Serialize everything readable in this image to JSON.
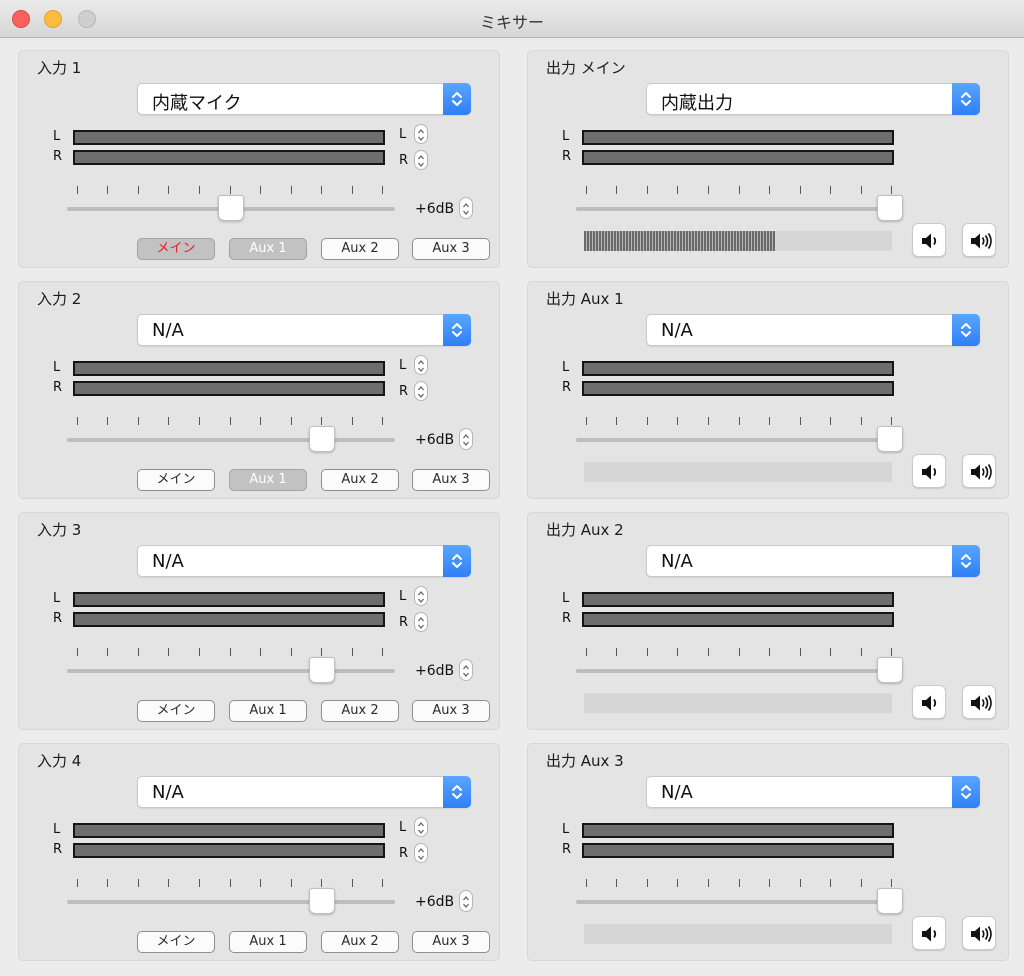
{
  "window": {
    "title": "ミキサー"
  },
  "inputs": [
    {
      "title": "入力 1",
      "source": "内蔵マイク",
      "level_fraction": 0.5,
      "gain_label": "+6dB",
      "routes": [
        {
          "label": "メイン",
          "state": "alert"
        },
        {
          "label": "Aux 1",
          "state": "active"
        },
        {
          "label": "Aux 2",
          "state": "normal"
        },
        {
          "label": "Aux 3",
          "state": "normal"
        }
      ]
    },
    {
      "title": "入力 2",
      "source": "N/A",
      "level_fraction": 0.777,
      "gain_label": "+6dB",
      "routes": [
        {
          "label": "メイン",
          "state": "normal"
        },
        {
          "label": "Aux 1",
          "state": "active"
        },
        {
          "label": "Aux 2",
          "state": "normal"
        },
        {
          "label": "Aux 3",
          "state": "normal"
        }
      ]
    },
    {
      "title": "入力 3",
      "source": "N/A",
      "level_fraction": 0.777,
      "gain_label": "+6dB",
      "routes": [
        {
          "label": "メイン",
          "state": "normal"
        },
        {
          "label": "Aux 1",
          "state": "normal"
        },
        {
          "label": "Aux 2",
          "state": "normal"
        },
        {
          "label": "Aux 3",
          "state": "normal"
        }
      ]
    },
    {
      "title": "入力 4",
      "source": "N/A",
      "level_fraction": 0.777,
      "gain_label": "+6dB",
      "routes": [
        {
          "label": "メイン",
          "state": "normal"
        },
        {
          "label": "Aux 1",
          "state": "normal"
        },
        {
          "label": "Aux 2",
          "state": "normal"
        },
        {
          "label": "Aux 3",
          "state": "normal"
        }
      ]
    }
  ],
  "outputs": [
    {
      "title": "出力 メイン",
      "device": "内蔵出力",
      "level_fraction": 1.0,
      "volume_fraction": 0.62
    },
    {
      "title": "出力 Aux 1",
      "device": "N/A",
      "level_fraction": 1.0,
      "volume_fraction": 0
    },
    {
      "title": "出力 Aux 2",
      "device": "N/A",
      "level_fraction": 1.0,
      "volume_fraction": 0
    },
    {
      "title": "出力 Aux 3",
      "device": "N/A",
      "level_fraction": 1.0,
      "volume_fraction": 0
    }
  ],
  "channel_labels": {
    "left": "L",
    "right": "R"
  },
  "icons": {
    "select": "up-down-chevron-icon",
    "stepper": "stepper-arrows-icon",
    "speaker_low": "speaker-low-icon",
    "speaker_high": "speaker-high-icon"
  },
  "colors": {
    "accent": "#2f7ff5",
    "alert_text": "#e02020",
    "meter": "#6e6e6e"
  }
}
